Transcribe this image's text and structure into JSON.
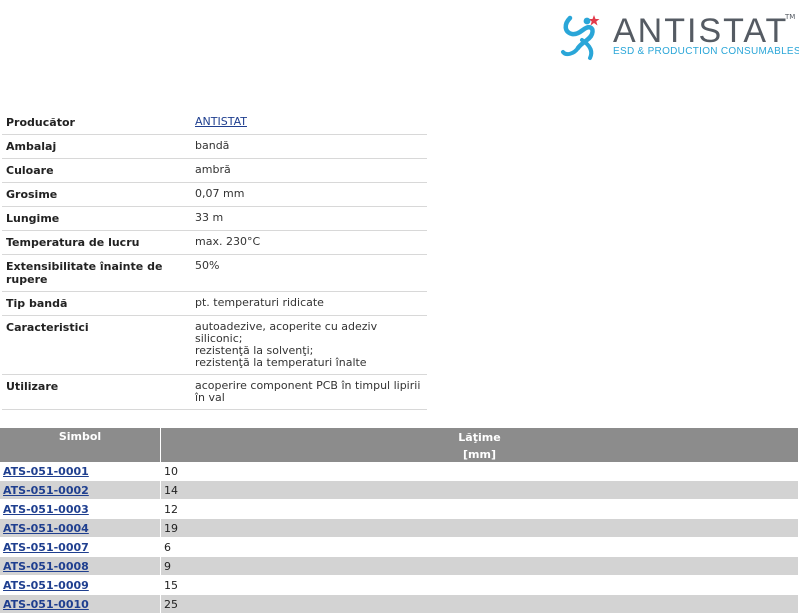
{
  "brand": {
    "name": "ANTISTAT",
    "trademark": "TM",
    "tagline": "ESD & PRODUCTION CONSUMABLES",
    "colors": {
      "text": "#555b63",
      "accent": "#2aa6d8",
      "star": "#e23a4a"
    }
  },
  "specs": [
    {
      "label": "Producător",
      "value": "ANTISTAT",
      "link": true
    },
    {
      "label": "Ambalaj",
      "value": "bandă"
    },
    {
      "label": "Culoare",
      "value": "ambră"
    },
    {
      "label": "Grosime",
      "value": "0,07 mm"
    },
    {
      "label": "Lungime",
      "value": "33 m"
    },
    {
      "label": "Temperatura de lucru",
      "value": "max. 230°C"
    },
    {
      "label": "Extensibilitate înainte de rupere",
      "value": "50%"
    },
    {
      "label": "Tip bandă",
      "value": "pt. temperaturi ridicate"
    },
    {
      "label": "Caracteristici",
      "value_lines": [
        "autoadezive, acoperite cu adeziv siliconic;",
        "rezistenţă la solvenţi;",
        "rezistenţă la temperaturi înalte"
      ]
    },
    {
      "label": "Utilizare",
      "value": "acoperire component PCB în timpul lipirii în val"
    }
  ],
  "symbols": {
    "headers": {
      "symbol": "Simbol",
      "width": "Lăţime",
      "width_unit": "[mm]"
    },
    "rows": [
      {
        "symbol": "ATS-051-0001",
        "width": "10"
      },
      {
        "symbol": "ATS-051-0002",
        "width": "14"
      },
      {
        "symbol": "ATS-051-0003",
        "width": "12"
      },
      {
        "symbol": "ATS-051-0004",
        "width": "19"
      },
      {
        "symbol": "ATS-051-0007",
        "width": "6"
      },
      {
        "symbol": "ATS-051-0008",
        "width": "9"
      },
      {
        "symbol": "ATS-051-0009",
        "width": "15"
      },
      {
        "symbol": "ATS-051-0010",
        "width": "25"
      }
    ]
  }
}
